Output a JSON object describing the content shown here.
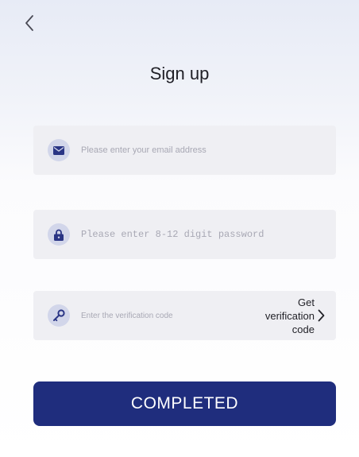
{
  "header": {
    "title": "Sign up"
  },
  "form": {
    "email": {
      "placeholder": "Please enter your email address",
      "icon": "envelope-icon"
    },
    "password": {
      "placeholder": "Please enter 8-12 digit password",
      "icon": "lock-icon"
    },
    "code": {
      "placeholder": "Enter the verification code",
      "icon": "key-icon",
      "get_code_lines": [
        "Get",
        "verification",
        "code"
      ]
    }
  },
  "submit": {
    "label": "COMPLETED"
  },
  "colors": {
    "primary": "#1f2d7d",
    "icon_bg": "#d2d6ea",
    "field_bg": "#efeff3"
  }
}
